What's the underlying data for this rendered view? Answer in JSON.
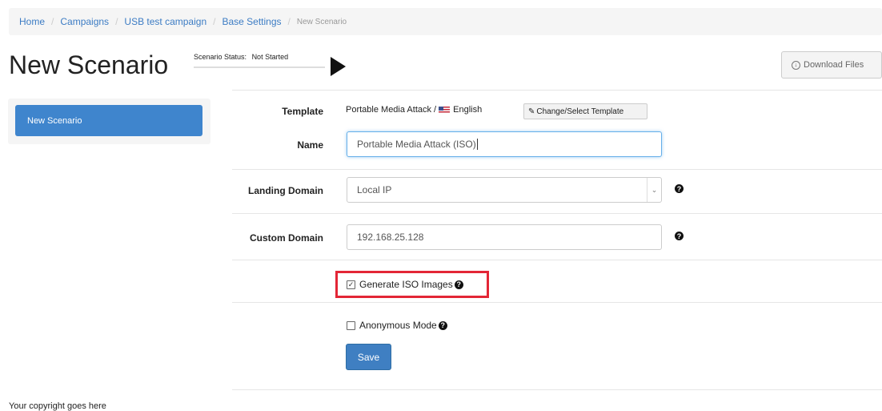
{
  "breadcrumb": {
    "home": "Home",
    "campaigns": "Campaigns",
    "campaign": "USB test campaign",
    "settings": "Base Settings",
    "current": "New Scenario",
    "separator": "/"
  },
  "header": {
    "title": "New Scenario",
    "status_label": "Scenario Status:",
    "status_value": "Not Started",
    "download_label": "Download Files"
  },
  "sidebar": {
    "items": [
      {
        "label": "New Scenario"
      }
    ]
  },
  "form": {
    "template_label": "Template",
    "template_value": "Portable Media Attack /",
    "template_language": "English",
    "change_template_label": "Change/Select Template",
    "name_label": "Name",
    "name_value": "Portable Media Attack (ISO)",
    "landing_domain_label": "Landing Domain",
    "landing_domain_value": "Local IP",
    "custom_domain_label": "Custom Domain",
    "custom_domain_value": "192.168.25.128",
    "generate_iso_label": "Generate ISO Images",
    "generate_iso_checked": true,
    "anonymous_mode_label": "Anonymous Mode",
    "anonymous_mode_checked": false,
    "save_label": "Save"
  },
  "footer": {
    "text": "Your copyright goes here"
  },
  "colors": {
    "primary": "#3f85cd",
    "link": "#3c7cc4",
    "highlight": "#e32636"
  }
}
